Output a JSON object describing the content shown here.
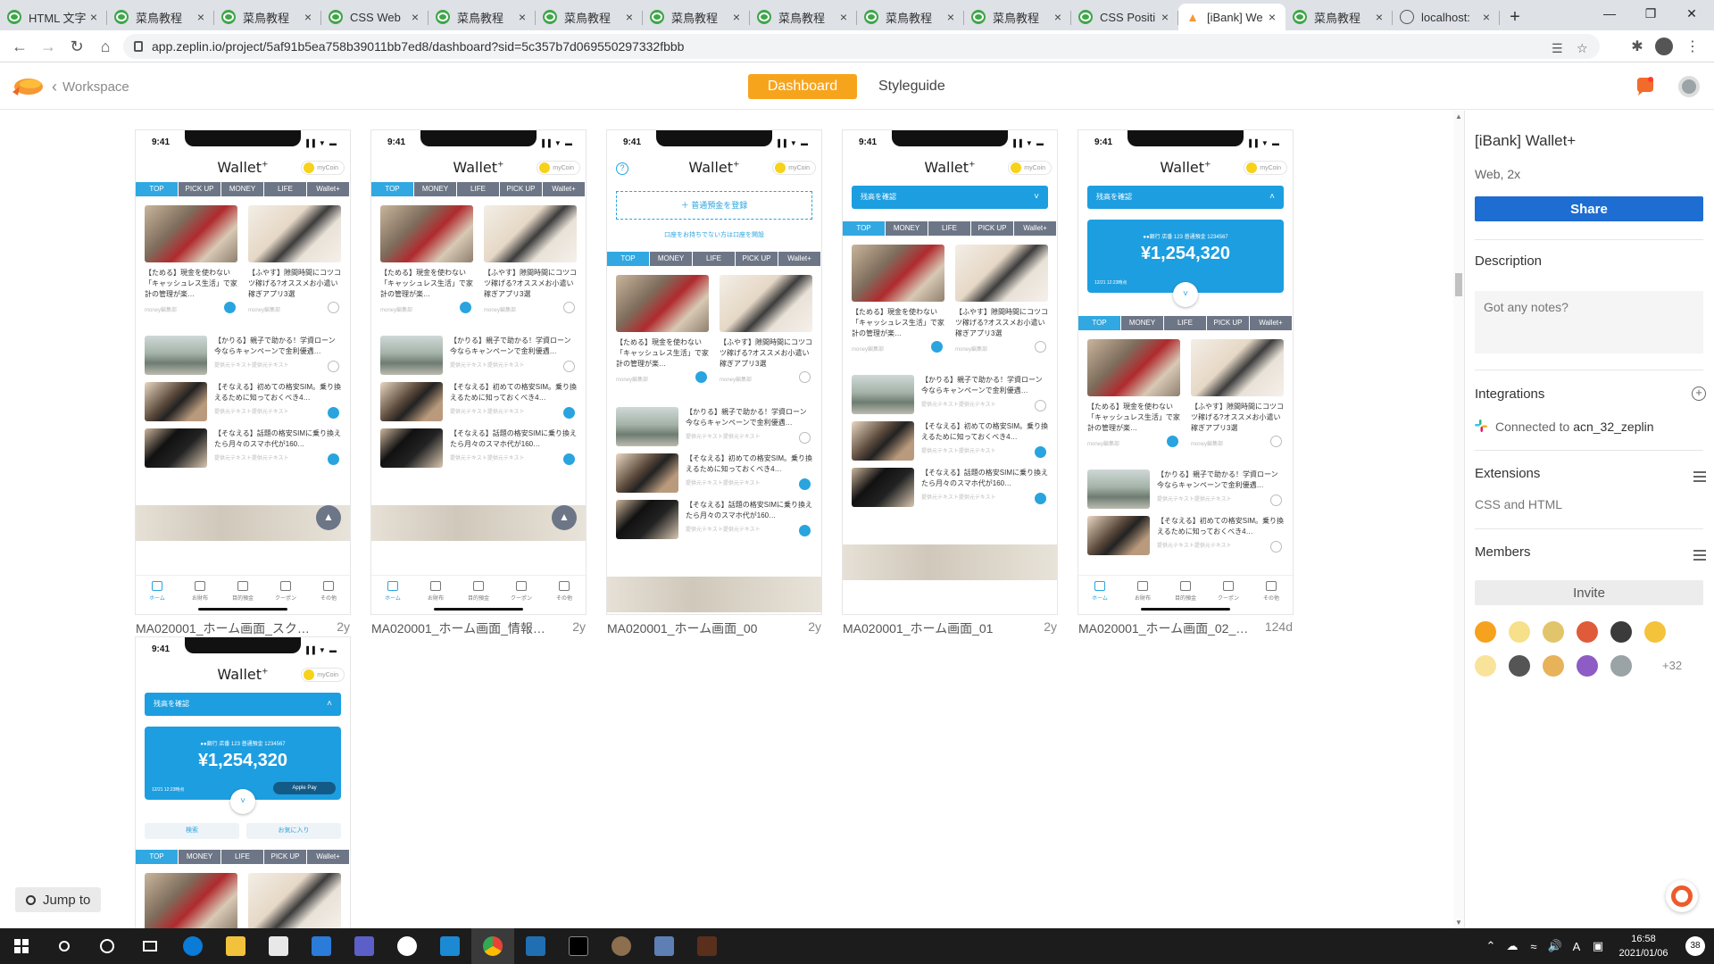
{
  "browser": {
    "tabs": [
      {
        "title": "HTML 文字",
        "icon": "green"
      },
      {
        "title": "菜鳥教程",
        "icon": "green"
      },
      {
        "title": "菜鳥教程",
        "icon": "green"
      },
      {
        "title": "CSS Web",
        "icon": "green"
      },
      {
        "title": "菜鳥教程",
        "icon": "green"
      },
      {
        "title": "菜鳥教程",
        "icon": "green"
      },
      {
        "title": "菜鳥教程",
        "icon": "green"
      },
      {
        "title": "菜鳥教程",
        "icon": "green"
      },
      {
        "title": "菜鳥教程",
        "icon": "green"
      },
      {
        "title": "菜鳥教程",
        "icon": "green"
      },
      {
        "title": "CSS Positi",
        "icon": "green"
      },
      {
        "title": "[iBank] We",
        "icon": "zeplin",
        "active": true
      },
      {
        "title": "菜鳥教程",
        "icon": "green"
      },
      {
        "title": "localhost:",
        "icon": "globe"
      }
    ],
    "url": "app.zeplin.io/project/5af91b5ea758b39011bb7ed8/dashboard?sid=5c357b7d069550297332fbbb"
  },
  "header": {
    "workspace": "Workspace",
    "dashboard": "Dashboard",
    "styleguide": "Styleguide"
  },
  "phone": {
    "time": "9:41",
    "logo": "Wallet",
    "logo_sup": "+",
    "coin": "myCoin",
    "tabs_a": [
      "TOP",
      "PICK UP",
      "MONEY",
      "LIFE",
      "Wallet+"
    ],
    "tabs_b": [
      "TOP",
      "MONEY",
      "LIFE",
      "PICK UP",
      "Wallet+"
    ],
    "card1": "【ためる】現金を使わない「キャッシュレス生活」で家計の管理が楽…",
    "card2": "【ふやす】隙間時間にコツコツ稼げる?オススメお小遣い稼ぎアプリ3選",
    "card_meta": "money編集部",
    "row1": "【かりる】親子で助かる！学資ローン今ならキャンペーンで金利優遇…",
    "row2": "【そなえる】初めての格安SIM。乗り換えるために知っておくべき4…",
    "row3": "【そなえる】話題の格安SIMに乗り換えたら月々のスマホ代が160…",
    "row_meta": "提供元テキスト提供元テキスト",
    "register": "＋ 普通預金を登録",
    "open_account": "口座をお持ちでない方は口座を開設",
    "balance_bar": "残高を確認",
    "account": "●●銀行 店番 123 普通預金 1234567",
    "amount": "¥1,254,320",
    "updated": "12/21 12:23時点",
    "apple_pay": "Apple Pay",
    "search": "検索",
    "favorites": "お気に入り",
    "nav": [
      "ホーム",
      "お財布",
      "目的預金",
      "クーポン",
      "その他"
    ]
  },
  "screens": [
    {
      "name": "MA020001_ホーム画面_スクロ…",
      "age": "2y"
    },
    {
      "name": "MA020001_ホーム画面_情報コ…",
      "age": "2y"
    },
    {
      "name": "MA020001_ホーム画面_00",
      "age": "2y"
    },
    {
      "name": "MA020001_ホーム画面_01",
      "age": "2y"
    },
    {
      "name": "MA020001_ホーム画面_02_…",
      "age": "124d"
    }
  ],
  "jump_to": "Jump to",
  "sidebar": {
    "title": "[iBank] Wallet+",
    "subtitle": "Web, 2x",
    "share": "Share",
    "description": "Description",
    "notes_placeholder": "Got any notes?",
    "integrations": "Integrations",
    "connected_prefix": "Connected to",
    "connected_name": "acn_32_zeplin",
    "extensions": "Extensions",
    "css_html": "CSS and HTML",
    "members": "Members",
    "invite": "Invite",
    "more_members": "+32"
  },
  "taskbar": {
    "time": "16:58",
    "date": "2021/01/06",
    "ime": "A",
    "notifications": "38"
  },
  "colors": {
    "accent_orange": "#f7a41d",
    "share_blue": "#1d6dd2",
    "app_blue": "#1d9ee0"
  }
}
